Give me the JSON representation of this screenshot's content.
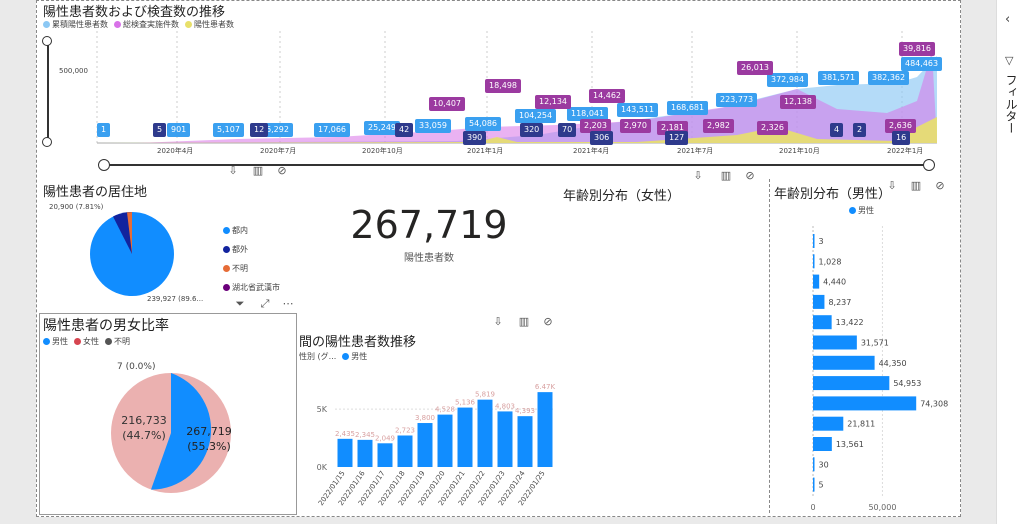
{
  "trend": {
    "title": "陽性患者数および検査数の推移",
    "legend": [
      {
        "label": "累積陽性患者数",
        "color": "#8cc8f4"
      },
      {
        "label": "総検査実施件数",
        "color": "#d872e8"
      },
      {
        "label": "陽性患者数",
        "color": "#e8e06a"
      }
    ],
    "y_tick": "500,000",
    "x_ticks": [
      "2020年4月",
      "2020年7月",
      "2020年10月",
      "2021年1月",
      "2021年4月",
      "2021年7月",
      "2021年10月",
      "2022年1月"
    ],
    "blue_tags": [
      "1",
      "901",
      "5,107",
      "6,292",
      "17,066",
      "25,249",
      "33,059",
      "54,086",
      "104,254",
      "118,041",
      "143,511",
      "168,681",
      "223,773",
      "372,984",
      "381,571",
      "382,362",
      "484,463"
    ],
    "purple_tags": [
      "10,407",
      "18,498",
      "12,134",
      "14,462",
      "2,203",
      "2,970",
      "2,181",
      "2,982",
      "26,013",
      "12,138",
      "2,326",
      "2,636",
      "39,816"
    ],
    "navy_tags": [
      "5",
      "12",
      "42",
      "390",
      "320",
      "70",
      "306",
      "127",
      "4",
      "2",
      "16"
    ]
  },
  "residence": {
    "title": "陽性患者の居住地",
    "label_top": "20,900 (7.81%)",
    "label_bottom": "239,927 (89.6...",
    "legend": [
      {
        "label": "都内",
        "color": "#118dff"
      },
      {
        "label": "都外",
        "color": "#12239e"
      },
      {
        "label": "不明",
        "color": "#e66c37"
      },
      {
        "label": "湖北省武漢市",
        "color": "#6b007b"
      }
    ]
  },
  "kpi": {
    "value": "267,719",
    "label": "陽性患者数"
  },
  "female_age": {
    "title": "年齢別分布（女性）"
  },
  "gender": {
    "title": "陽性患者の男女比率",
    "legend": [
      {
        "label": "男性",
        "color": "#118dff"
      },
      {
        "label": "女性",
        "color": "#d64550"
      },
      {
        "label": "不明",
        "color": "#555555"
      }
    ],
    "unknown_label": "7 (0.0%)",
    "female_value": "216,733",
    "female_pct": "(44.7%)",
    "male_value": "267,719",
    "male_pct": "(55.3%)"
  },
  "weekly": {
    "title": "間の陽性患者数推移",
    "legend_prefix": "性別 (グ...",
    "legend_item": "男性",
    "y_ticks": [
      "5K",
      "0K"
    ],
    "chart_data": {
      "type": "bar",
      "categories": [
        "2022/01/15",
        "2022/01/16",
        "2022/01/17",
        "2022/01/18",
        "2022/01/19",
        "2022/01/20",
        "2022/01/21",
        "2022/01/22",
        "2022/01/23",
        "2022/01/24",
        "2022/01/25"
      ],
      "values": [
        2435,
        2345,
        2049,
        2723,
        3800,
        4528,
        5136,
        5819,
        4803,
        4393,
        6470
      ],
      "labels": [
        "2,435",
        "2,345",
        "2,049",
        "2,723",
        "3,800",
        "4,528",
        "5,136",
        "5,819",
        "4,803",
        "4,393",
        "6.47K"
      ],
      "ylim": [
        0,
        7000
      ]
    }
  },
  "male_age": {
    "title": "年齢別分布（男性）",
    "legend_item": "男性",
    "x_ticks": [
      "0",
      "50,000"
    ],
    "chart_data": {
      "type": "bar",
      "orientation": "horizontal",
      "values": [
        3,
        1028,
        4440,
        8237,
        13422,
        31571,
        44350,
        54953,
        74308,
        21811,
        13561,
        30,
        5
      ],
      "labels": [
        "3",
        "1,028",
        "4,440",
        "8,237",
        "13,422",
        "31,571",
        "44,350",
        "54,953",
        "74,308",
        "21,811",
        "13,561",
        "30",
        "5"
      ],
      "xlim": [
        0,
        90000
      ]
    }
  },
  "filter_panel": {
    "label": "フィルター"
  }
}
